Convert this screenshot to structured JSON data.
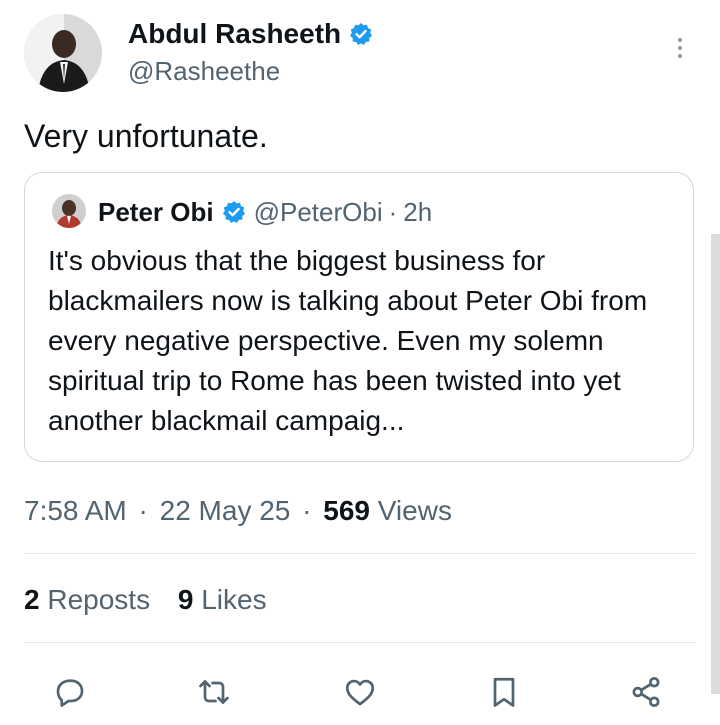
{
  "author": {
    "name": "Abdul Rasheeth",
    "handle": "@Rasheethe",
    "verified": true
  },
  "tweet": {
    "text": "Very unfortunate."
  },
  "quoted_tweet": {
    "name": "Peter Obi",
    "handle": "@PeterObi",
    "separator": "·",
    "time": "2h",
    "text": "It's obvious that the biggest business for blackmailers now is talking about Peter Obi from every negative perspective. Even my solemn spiritual trip to Rome has been twisted into yet another blackmail campaig..."
  },
  "meta": {
    "time": "7:58 AM",
    "date": "22 May 25",
    "separator": "·",
    "views_count": "569",
    "views_label": "Views"
  },
  "stats": {
    "reposts_count": "2",
    "reposts_label": "Reposts",
    "likes_count": "9",
    "likes_label": "Likes"
  },
  "icons": {
    "verified": "verified-badge-icon",
    "more": "more-vertical-icon",
    "reply": "reply-icon",
    "repost": "repost-icon",
    "like": "like-icon",
    "bookmark": "bookmark-icon",
    "share": "share-icon"
  },
  "colors": {
    "verified_blue": "#1d9bf0",
    "secondary_text": "#536471",
    "primary_text": "#0f1419",
    "border": "#cfd9de"
  }
}
